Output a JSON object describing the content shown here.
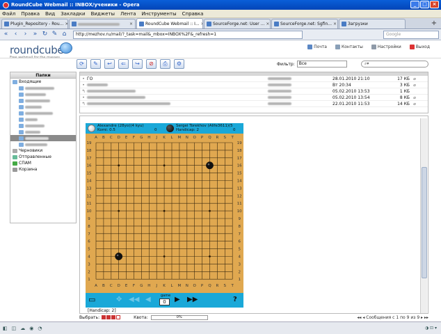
{
  "window": {
    "title": "RoundCube Webmail :: INBOX/ученики - Opera"
  },
  "menu": [
    "Файл",
    "Правка",
    "Вид",
    "Закладки",
    "Виджеты",
    "Лента",
    "Инструменты",
    "Справка"
  ],
  "tabs": [
    {
      "label": "Plugin_Repository - Rou..."
    },
    {
      "label": "Dropbox..."
    },
    {
      "label": "RoundCube Webmail :: I..."
    },
    {
      "label": "SourceForge.net: User ..."
    },
    {
      "label": "SourceForge.net: Sgfin..."
    },
    {
      "label": "Загрузки"
    }
  ],
  "nav": {
    "url": "http://mezhov.ru/mail/?_task=mail&_mbox=INBOX%2F&_refresh=1",
    "search_placeholder": "Google"
  },
  "logo": {
    "text": "roundcube",
    "tagline": "Free webmail for the masses"
  },
  "toplinks": [
    "Почта",
    "Контакты",
    "Настройки",
    "Выход"
  ],
  "filter": {
    "label": "Фильтр:",
    "value": "Все"
  },
  "folders": {
    "header": "Папки",
    "inbox": "Входящие",
    "drafts": "Черновики",
    "sent": "Отправленные",
    "spam": "СПАМ",
    "trash": "Корзина"
  },
  "messages": [
    {
      "subject": "ГО",
      "date": "28.01.2010 21:10",
      "size": "17 КБ",
      "att": "true"
    },
    {
      "subject": "",
      "date": "Вт 20:34",
      "size": "3 КБ",
      "att": "true"
    },
    {
      "subject": "",
      "date": "05.02.2010 13:53",
      "size": "1 КБ",
      "att": ""
    },
    {
      "subject": "",
      "date": "05.02.2010 13:54",
      "size": "8 КБ",
      "att": "true"
    },
    {
      "subject": "",
      "date": "22.01.2010 11:53",
      "size": "14 КБ",
      "att": "true"
    }
  ],
  "game": {
    "black": {
      "name": "Alexandre (28yo)(4 kyu)",
      "sub": "Komi: 0.5",
      "captures": "0"
    },
    "white": {
      "name": "Sergei Torekhov (Alife3611)(5",
      "sub": "Handicap: 2",
      "captures": "0"
    },
    "columns": [
      "A",
      "B",
      "C",
      "D",
      "E",
      "F",
      "G",
      "H",
      "J",
      "K",
      "L",
      "M",
      "N",
      "O",
      "P",
      "Q",
      "R",
      "S",
      "T"
    ],
    "rows": [
      "19",
      "18",
      "17",
      "16",
      "15",
      "14",
      "13",
      "12",
      "11",
      "10",
      "9",
      "8",
      "7",
      "6",
      "5",
      "4",
      "3",
      "2",
      "1"
    ],
    "stones": [
      {
        "col": "Q",
        "row": "16"
      },
      {
        "col": "D",
        "row": "4"
      }
    ],
    "move_label": "game",
    "move_value": "0",
    "handicap_note": "[Handicap: 2]"
  },
  "bottom": {
    "select_label": "Выбрать:",
    "quota_label": "Квота:",
    "quota_value": "0%",
    "count": "Сообщения с 1 по 9 из 9"
  }
}
